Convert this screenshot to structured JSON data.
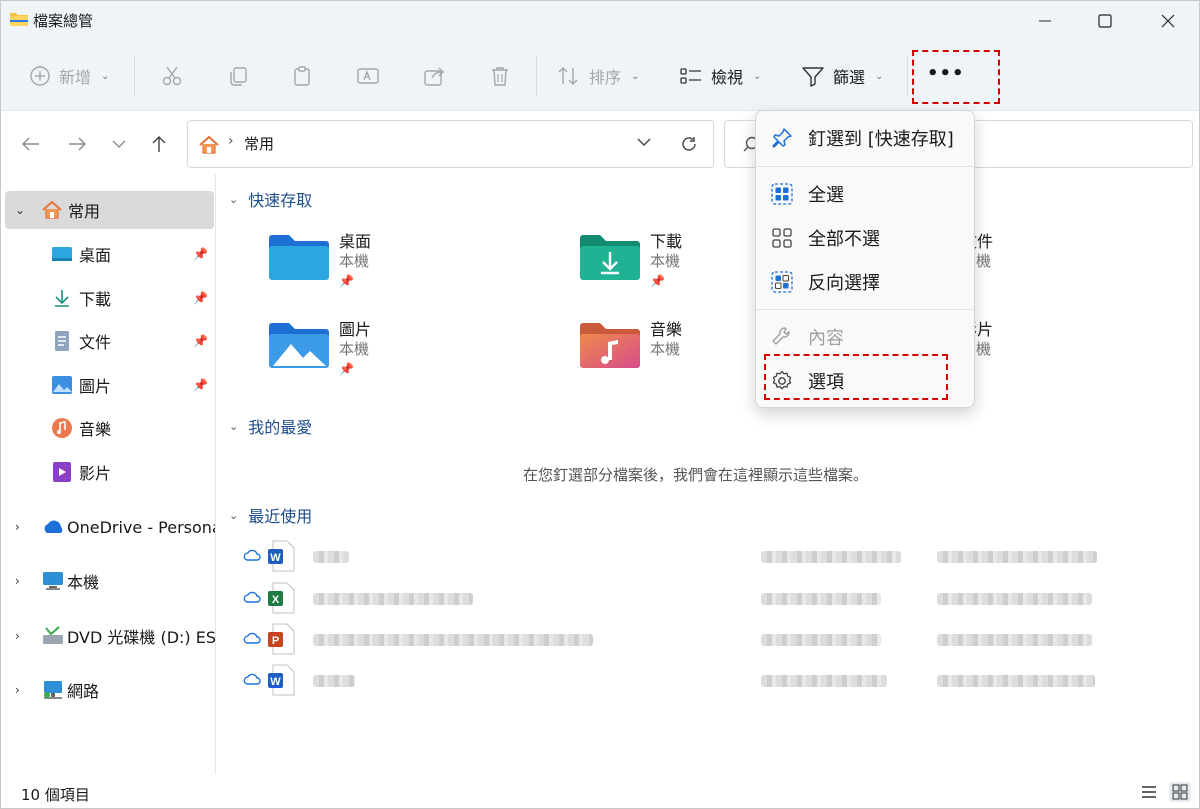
{
  "window": {
    "title": "檔案總管"
  },
  "toolbar": {
    "new_label": "新增",
    "sort_label": "排序",
    "view_label": "檢視",
    "filter_label": "篩選",
    "more_label": "•••"
  },
  "address": {
    "crumb": "常用"
  },
  "sidebar": {
    "items": [
      {
        "label": "常用"
      },
      {
        "label": "桌面"
      },
      {
        "label": "下載"
      },
      {
        "label": "文件"
      },
      {
        "label": "圖片"
      },
      {
        "label": "音樂"
      },
      {
        "label": "影片"
      },
      {
        "label": "OneDrive - Persona"
      },
      {
        "label": "本機"
      },
      {
        "label": "DVD 光碟機 (D:) ESD"
      },
      {
        "label": "網路"
      }
    ]
  },
  "content": {
    "quick_access": {
      "title": "快速存取",
      "tiles": [
        {
          "name": "桌面",
          "sub": "本機"
        },
        {
          "name": "下載",
          "sub": "本機"
        },
        {
          "name": "文件",
          "sub": "本機"
        },
        {
          "name": "圖片",
          "sub": "本機"
        },
        {
          "name": "音樂",
          "sub": "本機"
        },
        {
          "name": "影片",
          "sub": "本機"
        }
      ]
    },
    "favorites": {
      "title": "我的最愛",
      "empty_message": "在您釘選部分檔案後，我們會在這裡顯示這些檔案。"
    },
    "recent": {
      "title": "最近使用"
    }
  },
  "menu": {
    "items": [
      {
        "label": "釘選到 [快速存取]"
      },
      {
        "label": "全選"
      },
      {
        "label": "全部不選"
      },
      {
        "label": "反向選擇"
      },
      {
        "label": "內容"
      },
      {
        "label": "選項"
      }
    ]
  },
  "status": {
    "count": "10 個項目"
  },
  "colors": {
    "accent": "#0067c0",
    "highlight_box": "#d60000"
  }
}
